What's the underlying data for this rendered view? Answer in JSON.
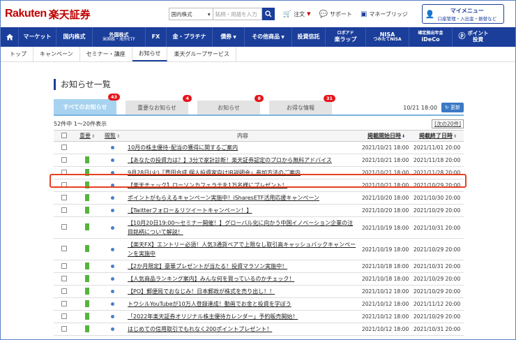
{
  "header": {
    "logo_en": "Rakuten",
    "logo_jp": "楽天証券",
    "search_select": "国内株式",
    "search_placeholder": "銘柄・用語を入力",
    "links": [
      {
        "label": "注文",
        "icon": "cart-icon"
      },
      {
        "label": "サポート",
        "icon": "chat-icon"
      },
      {
        "label": "マネーブリッジ",
        "icon": "bank-icon"
      }
    ],
    "mymenu_title": "マイメニュー",
    "mymenu_sub": "口座管理・入出金・振替など"
  },
  "nav": [
    {
      "l1": "マーケット",
      "l2": ""
    },
    {
      "l1": "国内株式",
      "l2": ""
    },
    {
      "l1": "外国株式",
      "l2": "米国株・海外ETF"
    },
    {
      "l1": "FX",
      "l2": ""
    },
    {
      "l1": "金・プラチナ",
      "l2": ""
    },
    {
      "l1": "債券",
      "l2": ""
    },
    {
      "l1": "その他商品",
      "l2": ""
    },
    {
      "l1": "投資信託",
      "l2": ""
    },
    {
      "l1": "ロボアド",
      "l2": "楽ラップ"
    },
    {
      "l1": "NISA",
      "l2": "つみたてNISA"
    },
    {
      "l1": "確定拠出年金",
      "l2": "iDeCo"
    },
    {
      "l1": "ポイント",
      "l2": "投資"
    }
  ],
  "subnav": [
    "トップ",
    "キャンペーン",
    "セミナー・講座",
    "お知らせ",
    "楽天グループサービス"
  ],
  "page_title": "お知らせ一覧",
  "tabs": [
    {
      "label": "すべてのお知らせ",
      "count": "43"
    },
    {
      "label": "重要なお知らせ",
      "count": "4"
    },
    {
      "label": "お知らせ",
      "count": "8"
    },
    {
      "label": "お得な情報",
      "count": "31"
    }
  ],
  "updated_time": "10/21 18:00",
  "refresh_label": "更新",
  "list_count": "52件中 1〜20件表示",
  "next_link": "[次の20件]",
  "columns": {
    "important": "重要",
    "read": "閲覧",
    "content": "内容",
    "start": "掲載開始日時",
    "end": "掲載終了日時"
  },
  "rows": [
    {
      "flag": false,
      "text": "10月の株主優待･配当の獲得に関するご案内",
      "start": "2021/10/21 18:00",
      "end": "2021/11/01 20:00"
    },
    {
      "flag": true,
      "text": "【あなたの投資力は？】3分で家計診断！楽天証券認定のプロから無料アドバイス",
      "start": "2021/10/21 18:00",
      "end": "2021/11/18 20:00"
    },
    {
      "flag": true,
      "text": "9月28日(火)「豊田合成 個人投資家向けIR説明会」参加方法のご案内",
      "start": "2021/10/21 18:00",
      "end": "2021/11/28 20:00"
    },
    {
      "flag": true,
      "text": "【楽天チェック】ローソンカフェラテを1万名様にプレゼント！",
      "start": "2021/10/21 18:00",
      "end": "2021/10/29 20:00"
    },
    {
      "flag": true,
      "text": "ポイントがもらえるキャンペーン実施中！iSharesETF活用応援キャンペーン",
      "start": "2021/10/20 18:00",
      "end": "2021/10/30 20:00"
    },
    {
      "flag": true,
      "text": "【Twitterフォロー＆リツイートキャンペーン！】",
      "start": "2021/10/20 18:00",
      "end": "2021/10/29 20:00"
    },
    {
      "flag": true,
      "text": "【10月20日19:00〜セミナー開催！】グローバル化に向かう中国イノベーション企業の注目銘柄について解説！",
      "start": "2021/10/19 18:00",
      "end": "2021/10/31 20:00"
    },
    {
      "flag": true,
      "text": "【楽天FX】エントリー必須！人気3通貨ペアで上限なし取引高キャッシュバックキャンペーンを実施中",
      "start": "2021/10/19 18:00",
      "end": "2021/10/29 20:00"
    },
    {
      "flag": true,
      "text": "【2か月限定】豪華プレゼントが当たる！投資マラソン実施中！",
      "start": "2021/10/18 18:00",
      "end": "2021/10/31 20:00"
    },
    {
      "flag": true,
      "text": "【人気商品ランキング案内】みんな何を買っているのかチェック！",
      "start": "2021/10/18 18:00",
      "end": "2021/10/29 20:00"
    },
    {
      "flag": true,
      "text": "【PO】郵便局でおなじみ！日本郵政が株式を売り出し！！",
      "start": "2021/10/12 18:00",
      "end": "2021/10/29 20:00"
    },
    {
      "flag": true,
      "text": "トウシルYouTubeが10万人登録達成！動画でお金と投資を学ぼう",
      "start": "2021/10/12 18:00",
      "end": "2021/11/12 20:00"
    },
    {
      "flag": true,
      "text": "「2022年楽天証券オリジナル株主優待カレンダー」予約販売開始！",
      "start": "2021/10/12 18:00",
      "end": "2021/10/29 20:00"
    },
    {
      "flag": true,
      "text": "はじめての信用取引でもれなく200ポイントプレゼント！",
      "start": "2021/10/12 18:00",
      "end": "2021/10/31 20:00"
    }
  ]
}
